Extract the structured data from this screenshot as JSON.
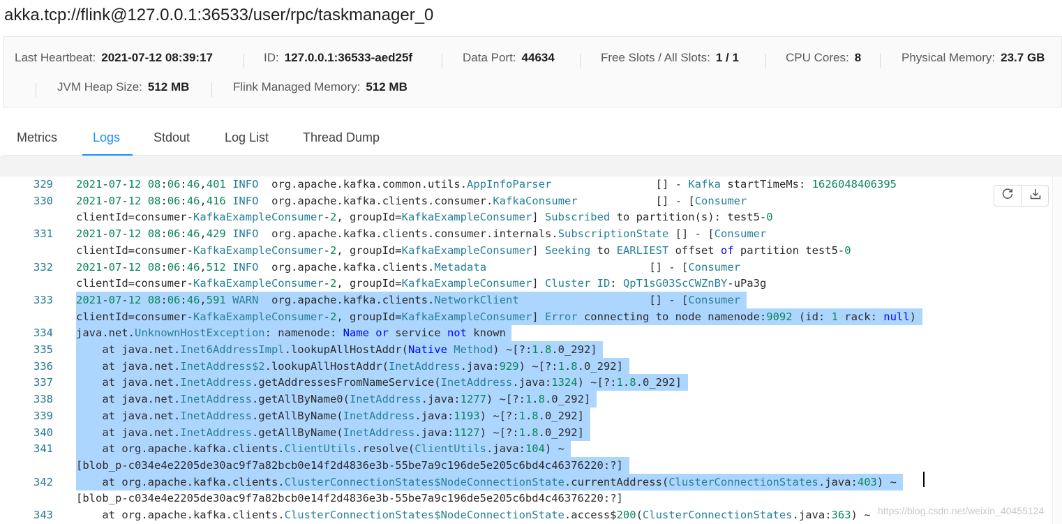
{
  "page_title": "akka.tcp://flink@127.0.0.1:36533/user/rpc/taskmanager_0",
  "details": {
    "last_heartbeat": {
      "label": "Last Heartbeat:",
      "value": "2021-07-12 08:39:17"
    },
    "id": {
      "label": "ID:",
      "value": "127.0.0.1:36533-aed25f"
    },
    "data_port": {
      "label": "Data Port:",
      "value": "44634"
    },
    "slots": {
      "label": "Free Slots / All Slots:",
      "value": "1 / 1"
    },
    "cpu_cores": {
      "label": "CPU Cores:",
      "value": "8"
    },
    "physical_memory": {
      "label": "Physical Memory:",
      "value": "23.7 GB"
    },
    "jvm_heap": {
      "label": "JVM Heap Size:",
      "value": "512 MB"
    },
    "managed_memory": {
      "label": "Flink Managed Memory:",
      "value": "512 MB"
    }
  },
  "tabs": [
    {
      "label": "Metrics",
      "active": false
    },
    {
      "label": "Logs",
      "active": true
    },
    {
      "label": "Stdout",
      "active": false
    },
    {
      "label": "Log List",
      "active": false
    },
    {
      "label": "Thread Dump",
      "active": false
    }
  ],
  "actions": {
    "reload_icon": "reload-icon",
    "download_icon": "download-icon"
  },
  "colors": {
    "accent": "#1890ff",
    "selection": "#add6ff",
    "line_number": "#237893",
    "class_token": "#267f99",
    "keyword": "#0000ff",
    "number": "#098658"
  },
  "logs": {
    "lines": [
      {
        "num": "329",
        "text": "2021-07-12 08:06:46,401 INFO  org.apache.kafka.common.utils.AppInfoParser                [] - Kafka startTimeMs: 1626048406395",
        "selected": false
      },
      {
        "num": "330",
        "text": "2021-07-12 08:06:46,416 INFO  org.apache.kafka.clients.consumer.KafkaConsumer            [] - [Consumer",
        "selected": false
      },
      {
        "num": "",
        "text": "clientId=consumer-KafkaExampleConsumer-2, groupId=KafkaExampleConsumer] Subscribed to partition(s): test5-0",
        "selected": false
      },
      {
        "num": "331",
        "text": "2021-07-12 08:06:46,429 INFO  org.apache.kafka.clients.consumer.internals.SubscriptionState [] - [Consumer",
        "selected": false
      },
      {
        "num": "",
        "text": "clientId=consumer-KafkaExampleConsumer-2, groupId=KafkaExampleConsumer] Seeking to EARLIEST offset of partition test5-0",
        "selected": false
      },
      {
        "num": "332",
        "text": "2021-07-12 08:06:46,512 INFO  org.apache.kafka.clients.Metadata                         [] - [Consumer",
        "selected": false
      },
      {
        "num": "",
        "text": "clientId=consumer-KafkaExampleConsumer-2, groupId=KafkaExampleConsumer] Cluster ID: QpT1sG03ScCWZnBY-uPa3g",
        "selected": false
      },
      {
        "num": "333",
        "text": "2021-07-12 08:06:46,591 WARN  org.apache.kafka.clients.NetworkClient                    [] - [Consumer",
        "selected": true
      },
      {
        "num": "",
        "text": "clientId=consumer-KafkaExampleConsumer-2, groupId=KafkaExampleConsumer] Error connecting to node namenode:9092 (id: 1 rack: null)",
        "selected": true
      },
      {
        "num": "334",
        "text": "java.net.UnknownHostException: namenode: Name or service not known",
        "selected": true
      },
      {
        "num": "335",
        "text": "    at java.net.Inet6AddressImpl.lookupAllHostAddr(Native Method) ~[?:1.8.0_292]",
        "selected": true
      },
      {
        "num": "336",
        "text": "    at java.net.InetAddress$2.lookupAllHostAddr(InetAddress.java:929) ~[?:1.8.0_292]",
        "selected": true
      },
      {
        "num": "337",
        "text": "    at java.net.InetAddress.getAddressesFromNameService(InetAddress.java:1324) ~[?:1.8.0_292]",
        "selected": true
      },
      {
        "num": "338",
        "text": "    at java.net.InetAddress.getAllByName0(InetAddress.java:1277) ~[?:1.8.0_292]",
        "selected": true
      },
      {
        "num": "339",
        "text": "    at java.net.InetAddress.getAllByName(InetAddress.java:1193) ~[?:1.8.0_292]",
        "selected": true
      },
      {
        "num": "340",
        "text": "    at java.net.InetAddress.getAllByName(InetAddress.java:1127) ~[?:1.8.0_292]",
        "selected": true
      },
      {
        "num": "341",
        "text": "    at org.apache.kafka.clients.ClientUtils.resolve(ClientUtils.java:104) ~",
        "selected": true
      },
      {
        "num": "",
        "text": "[blob_p-c034e4e2205de30ac9f7a82bcb0e14f2d4836e3b-55be7a9c196de5e205c6bd4c46376220:?]",
        "selected": true
      },
      {
        "num": "342",
        "text": "    at org.apache.kafka.clients.ClusterConnectionStates$NodeConnectionState.currentAddress(ClusterConnectionStates.java:403) ~",
        "selected": true
      },
      {
        "num": "",
        "text": "[blob_p-c034e4e2205de30ac9f7a82bcb0e14f2d4836e3b-55be7a9c196de5e205c6bd4c46376220:?]",
        "selected": false
      },
      {
        "num": "343",
        "text": "    at org.apache.kafka.clients.ClusterConnectionStates$NodeConnectionState.access$200(ClusterConnectionStates.java:363) ~",
        "selected": false
      }
    ]
  },
  "watermark": "https://blog.csdn.net/weixin_40455124"
}
